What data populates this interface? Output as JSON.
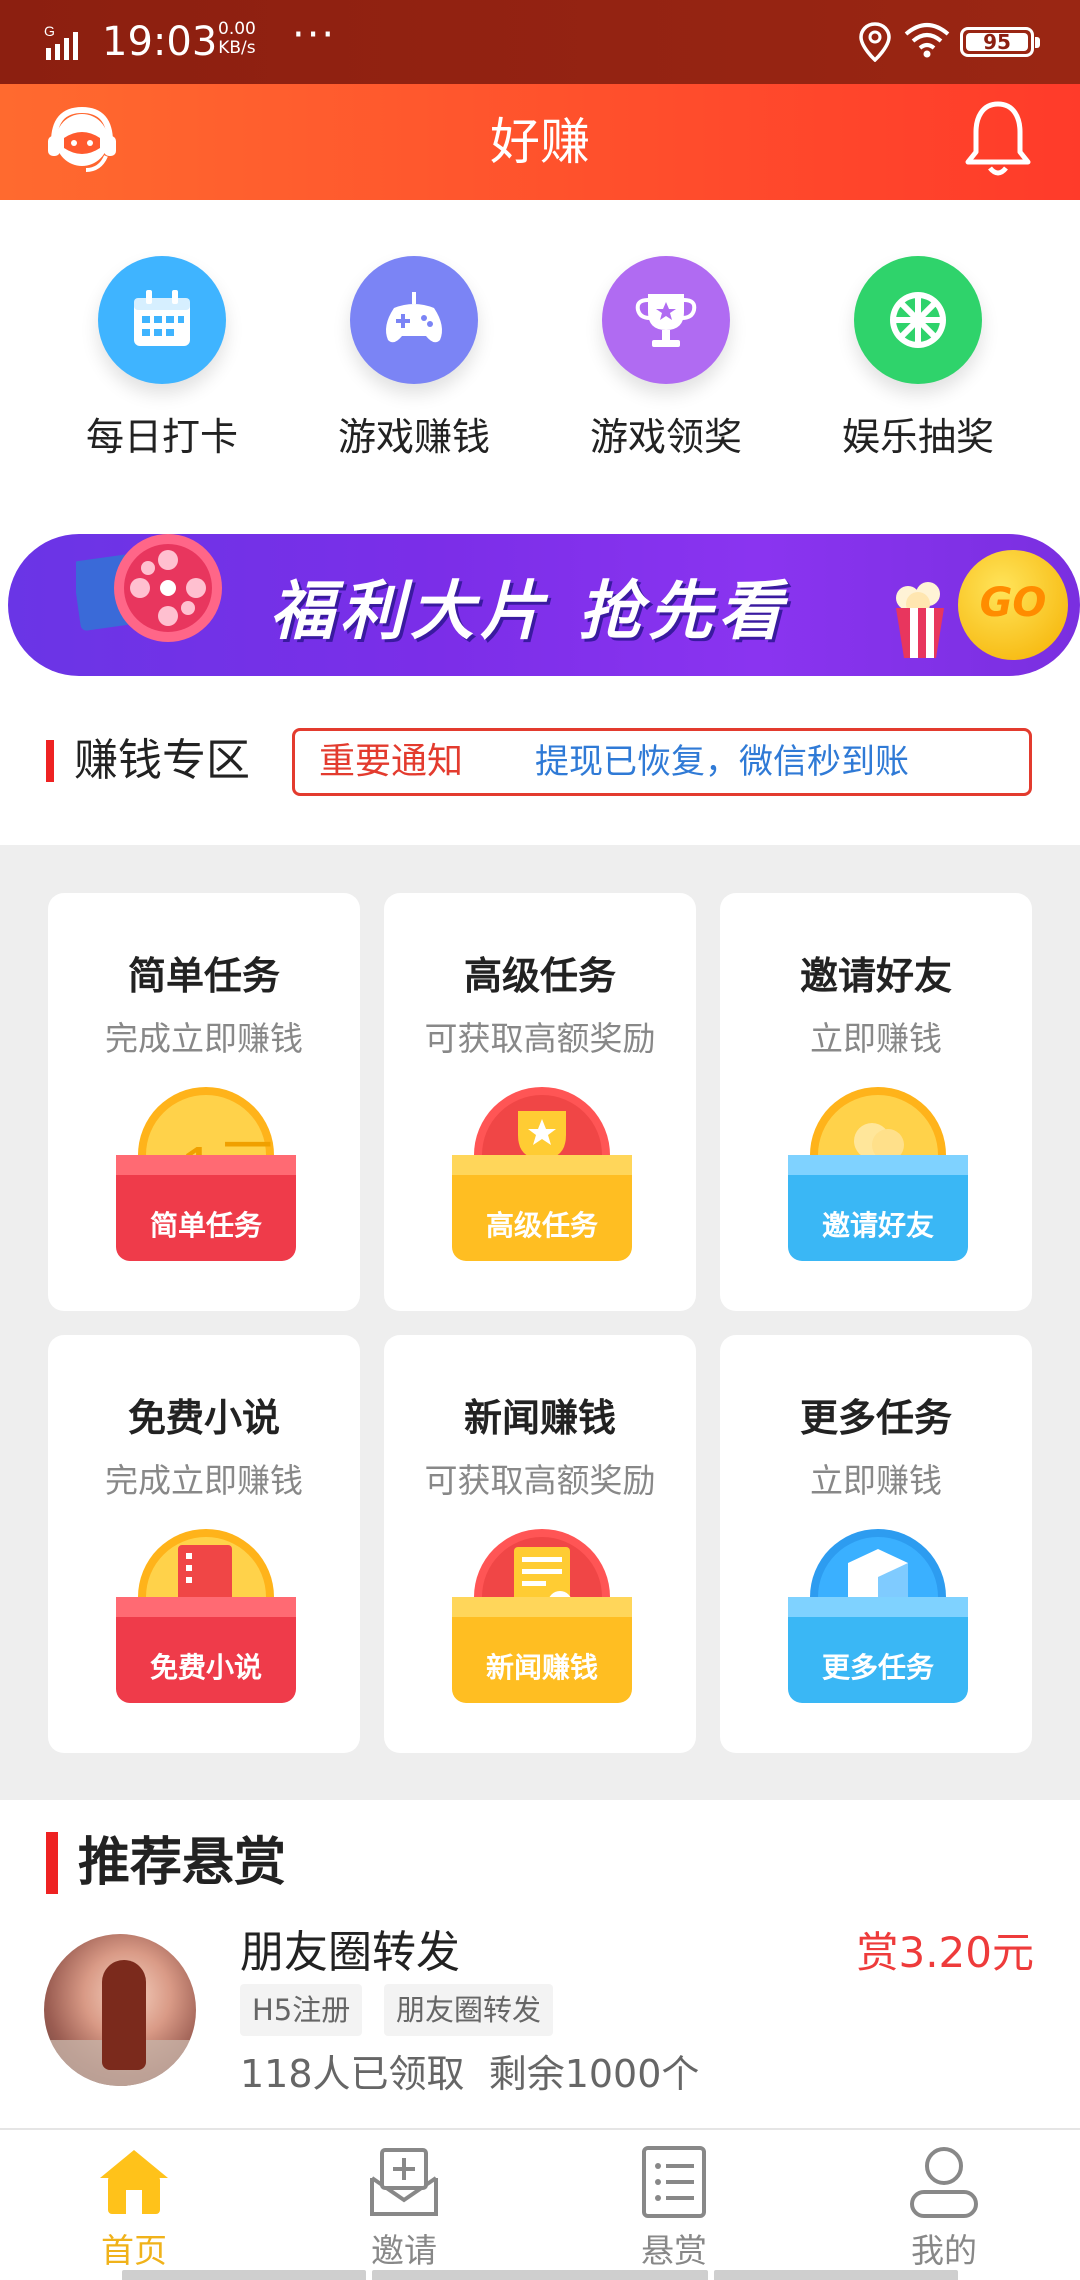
{
  "status_bar": {
    "network": "G",
    "time": "19:03",
    "speed_value": "0.00",
    "speed_unit": "KB/s",
    "more": "···",
    "battery": "95",
    "icons": [
      "signal-icon",
      "location-icon",
      "wifi-icon",
      "battery-icon"
    ]
  },
  "app_bar": {
    "title": "好赚",
    "left_icon": "customer-service-icon",
    "right_icon": "bell-icon"
  },
  "quick_actions": [
    {
      "label": "每日打卡",
      "icon": "calendar-icon",
      "color": "#3fb4ff"
    },
    {
      "label": "游戏赚钱",
      "icon": "gamepad-icon",
      "color": "#7b84f5"
    },
    {
      "label": "游戏领奖",
      "icon": "trophy-icon",
      "color": "#b06bf2"
    },
    {
      "label": "娱乐抽奖",
      "icon": "wheel-icon",
      "color": "#2fd36b"
    }
  ],
  "banner": {
    "text": "福利大片 抢先看",
    "go": "GO"
  },
  "earn_zone": {
    "title": "赚钱专区",
    "notice_tag": "重要通知",
    "notice_msg": "提现已恢复，微信秒到账"
  },
  "tasks": [
    {
      "title": "简单任务",
      "subtitle": "完成立即赚钱",
      "badge": "简单任务",
      "coin_text": "1元",
      "theme": "red"
    },
    {
      "title": "高级任务",
      "subtitle": "可获取高额奖励",
      "badge": "高级任务",
      "theme": "gold"
    },
    {
      "title": "邀请好友",
      "subtitle": "立即赚钱",
      "badge": "邀请好友",
      "theme": "blue"
    },
    {
      "title": "免费小说",
      "subtitle": "完成立即赚钱",
      "badge": "免费小说",
      "theme": "red"
    },
    {
      "title": "新闻赚钱",
      "subtitle": "可获取高额奖励",
      "badge": "新闻赚钱",
      "theme": "gold"
    },
    {
      "title": "更多任务",
      "subtitle": "立即赚钱",
      "badge": "更多任务",
      "theme": "blue"
    }
  ],
  "recommended": {
    "title": "推荐悬赏",
    "item": {
      "name": "朋友圈转发",
      "reward": "赏3.20元",
      "tags": [
        "H5注册",
        "朋友圈转发"
      ],
      "claimed": "118人已领取",
      "remaining": "剩余1000个"
    }
  },
  "bottom_nav": [
    {
      "label": "首页",
      "icon": "home-icon",
      "active": true
    },
    {
      "label": "邀请",
      "icon": "invite-icon",
      "active": false
    },
    {
      "label": "悬赏",
      "icon": "list-icon",
      "active": false
    },
    {
      "label": "我的",
      "icon": "profile-icon",
      "active": false
    }
  ]
}
